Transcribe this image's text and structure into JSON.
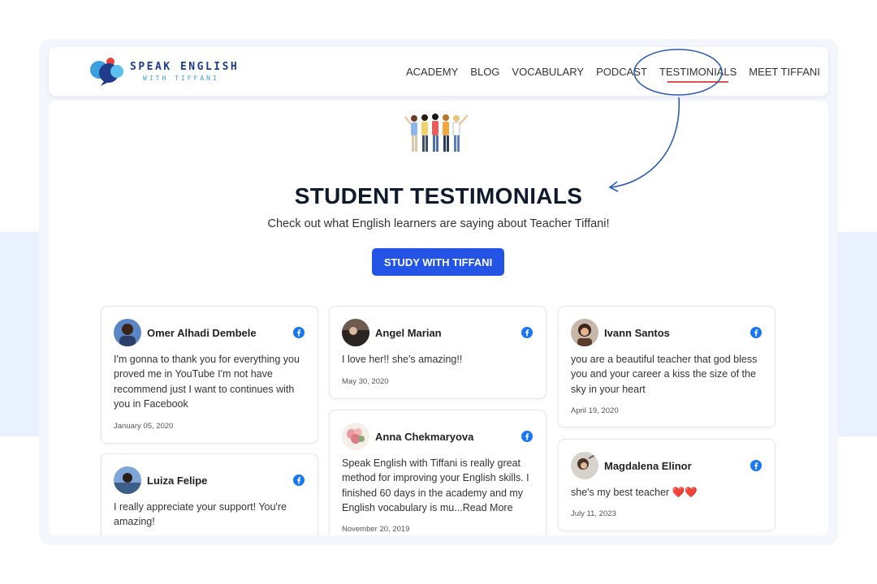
{
  "brand": {
    "line1": "SPEAK ENGLISH",
    "line2": "WITH TIFFANI",
    "colors": {
      "primary": "#1f3d8a",
      "accent": "#3aa0e0",
      "button": "#2454e6"
    }
  },
  "nav": {
    "items": [
      {
        "label": "ACADEMY"
      },
      {
        "label": "BLOG"
      },
      {
        "label": "VOCABULARY"
      },
      {
        "label": "PODCAST"
      },
      {
        "label": "TESTIMONIALS",
        "active": true
      },
      {
        "label": "MEET TIFFANI"
      }
    ]
  },
  "hero": {
    "title": "STUDENT TESTIMONIALS",
    "subtitle": "Check out what English learners are saying about Teacher Tiffani!",
    "cta_label": "STUDY WITH TIFFANI",
    "illustration_icon": "group-of-people-icon"
  },
  "testimonials": [
    {
      "name": "Omer Alhadi Dembele",
      "text": "I'm gonna to thank you for everything you proved me in YouTube I'm not have recommend just I want to continues with you in Facebook",
      "date": "January 05, 2020",
      "source_icon": "facebook-icon"
    },
    {
      "name": "Luiza Felipe",
      "text": "I really appreciate your support! You're amazing!",
      "source_icon": "facebook-icon"
    },
    {
      "name": "Angel Marian",
      "text": "I love her!! she's amazing!!",
      "date": "May 30, 2020",
      "source_icon": "facebook-icon"
    },
    {
      "name": "Anna Chekmaryova",
      "text": "Speak English with Tiffani is really great method for improving your English skills. I finished 60 days in the academy and my English vocabulary is mu...",
      "read_more": "Read More",
      "date": "November 20, 2019",
      "source_icon": "facebook-icon"
    },
    {
      "name": "Ivann Santos",
      "text": "you are a beautiful teacher that god bless you and your career a kiss the size of the sky in your heart",
      "date": "April 19, 2020",
      "source_icon": "facebook-icon"
    },
    {
      "name": "Magdalena Elinor",
      "text": "she's my best teacher ❤️❤️",
      "date": "July 11, 2023",
      "source_icon": "facebook-icon"
    }
  ]
}
